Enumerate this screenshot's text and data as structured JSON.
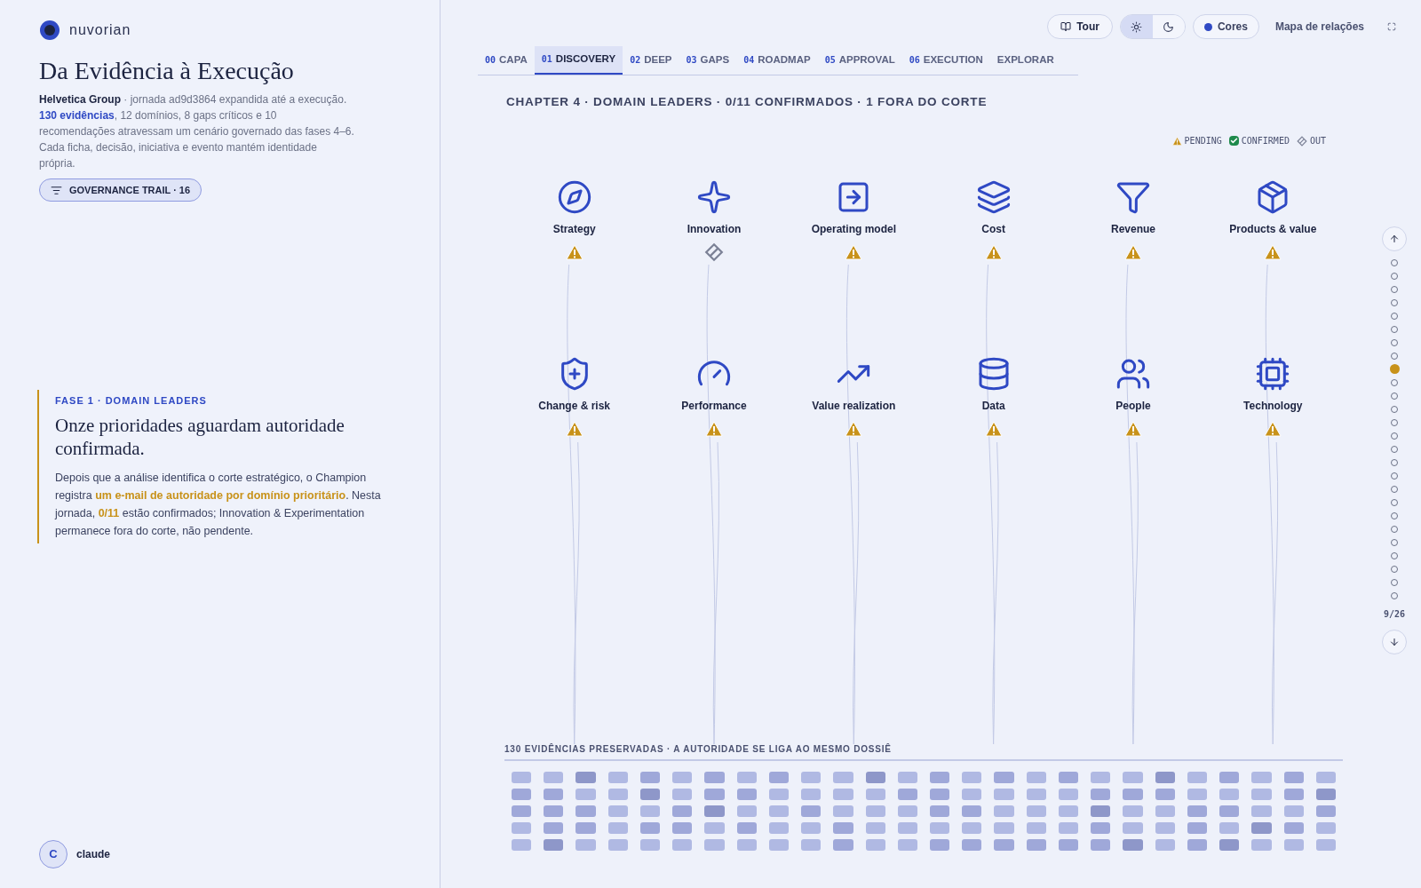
{
  "brand": {
    "name": "nuvorian"
  },
  "intro": {
    "title": "Da Evidência à Execução",
    "description": [
      {
        "kind": "strong",
        "text": "Helvetica Group"
      },
      {
        "kind": "plain",
        "text": " · jornada ad9d3864 expandida até a execução. "
      },
      {
        "kind": "accent",
        "text": "130 evidências"
      },
      {
        "kind": "plain",
        "text": ", 12 domínios, 8 gaps críticos e 10 recomendações atravessam um cenário governado das fases 4–6. Cada ficha, decisão, iniciativa e evento mantém identidade própria."
      }
    ],
    "trail_button": "GOVERNANCE TRAIL · 16"
  },
  "phase": {
    "eyebrow": "FASE 1 · DOMAIN LEADERS",
    "heading": "Onze prioridades aguardam autoridade confirmada.",
    "body": [
      {
        "kind": "plain",
        "text": "Depois que a análise identifica o corte estratégico, o Champion registra "
      },
      {
        "kind": "highlight",
        "text": "um e-mail de autoridade por domínio prioritário"
      },
      {
        "kind": "plain",
        "text": ". Nesta jornada, "
      },
      {
        "kind": "highlight",
        "text": "0/11"
      },
      {
        "kind": "plain",
        "text": " estão confirmados; Innovation & Experimentation permanece fora do corte, não pendente."
      }
    ]
  },
  "user": {
    "initial": "C",
    "name": "claude"
  },
  "toolbar": {
    "tour": "Tour",
    "themes": [
      {
        "kind": "light",
        "selected": true
      },
      {
        "kind": "dark",
        "selected": false
      }
    ],
    "colors": "Cores",
    "map_link": "Mapa de relações"
  },
  "tabs": [
    {
      "num": "00",
      "label": "CAPA",
      "selected": false
    },
    {
      "num": "01",
      "label": "DISCOVERY",
      "selected": true
    },
    {
      "num": "02",
      "label": "DEEP",
      "selected": false
    },
    {
      "num": "03",
      "label": "GAPS",
      "selected": false
    },
    {
      "num": "04",
      "label": "ROADMAP",
      "selected": false
    },
    {
      "num": "05",
      "label": "APPROVAL",
      "selected": false
    },
    {
      "num": "06",
      "label": "EXECUTION",
      "selected": false
    },
    {
      "label": "EXPLORAR",
      "selected": false
    }
  ],
  "chapter": "CHAPTER 4 · DOMAIN LEADERS · 0/11 CONFIRMADOS · 1 FORA DO CORTE",
  "legend": [
    {
      "kind": "pending",
      "label": "PENDING"
    },
    {
      "kind": "confirmed",
      "label": "CONFIRMED"
    },
    {
      "kind": "out",
      "label": "OUT"
    }
  ],
  "domains": [
    {
      "label": "Strategy",
      "kind": "pending"
    },
    {
      "label": "Innovation",
      "kind": "out"
    },
    {
      "label": "Operating model",
      "kind": "pending"
    },
    {
      "label": "Cost",
      "kind": "pending"
    },
    {
      "label": "Revenue",
      "kind": "pending"
    },
    {
      "label": "Products & value",
      "kind": "pending"
    },
    {
      "label": "Change & risk",
      "kind": "pending"
    },
    {
      "label": "Performance",
      "kind": "pending"
    },
    {
      "label": "Value realization",
      "kind": "pending"
    },
    {
      "label": "Data",
      "kind": "pending"
    },
    {
      "label": "People",
      "kind": "pending"
    },
    {
      "label": "Technology",
      "kind": "pending"
    }
  ],
  "evidence": {
    "title": "130 EVIDÊNCIAS PRESERVADAS · A AUTORIDADE SE LIGA AO MESMO DOSSIÊ"
  },
  "pager": {
    "dots": [
      {
        "selected": false
      },
      {
        "selected": false
      },
      {
        "selected": false
      },
      {
        "selected": false
      },
      {
        "selected": false
      },
      {
        "selected": false
      },
      {
        "selected": false
      },
      {
        "selected": false
      },
      {
        "selected": true
      },
      {
        "selected": false
      },
      {
        "selected": false
      },
      {
        "selected": false
      },
      {
        "selected": false
      },
      {
        "selected": false
      },
      {
        "selected": false
      },
      {
        "selected": false
      },
      {
        "selected": false
      },
      {
        "selected": false
      },
      {
        "selected": false
      },
      {
        "selected": false
      },
      {
        "selected": false
      },
      {
        "selected": false
      },
      {
        "selected": false
      },
      {
        "selected": false
      },
      {
        "selected": false
      },
      {
        "selected": false
      }
    ],
    "reading": "9/26"
  }
}
